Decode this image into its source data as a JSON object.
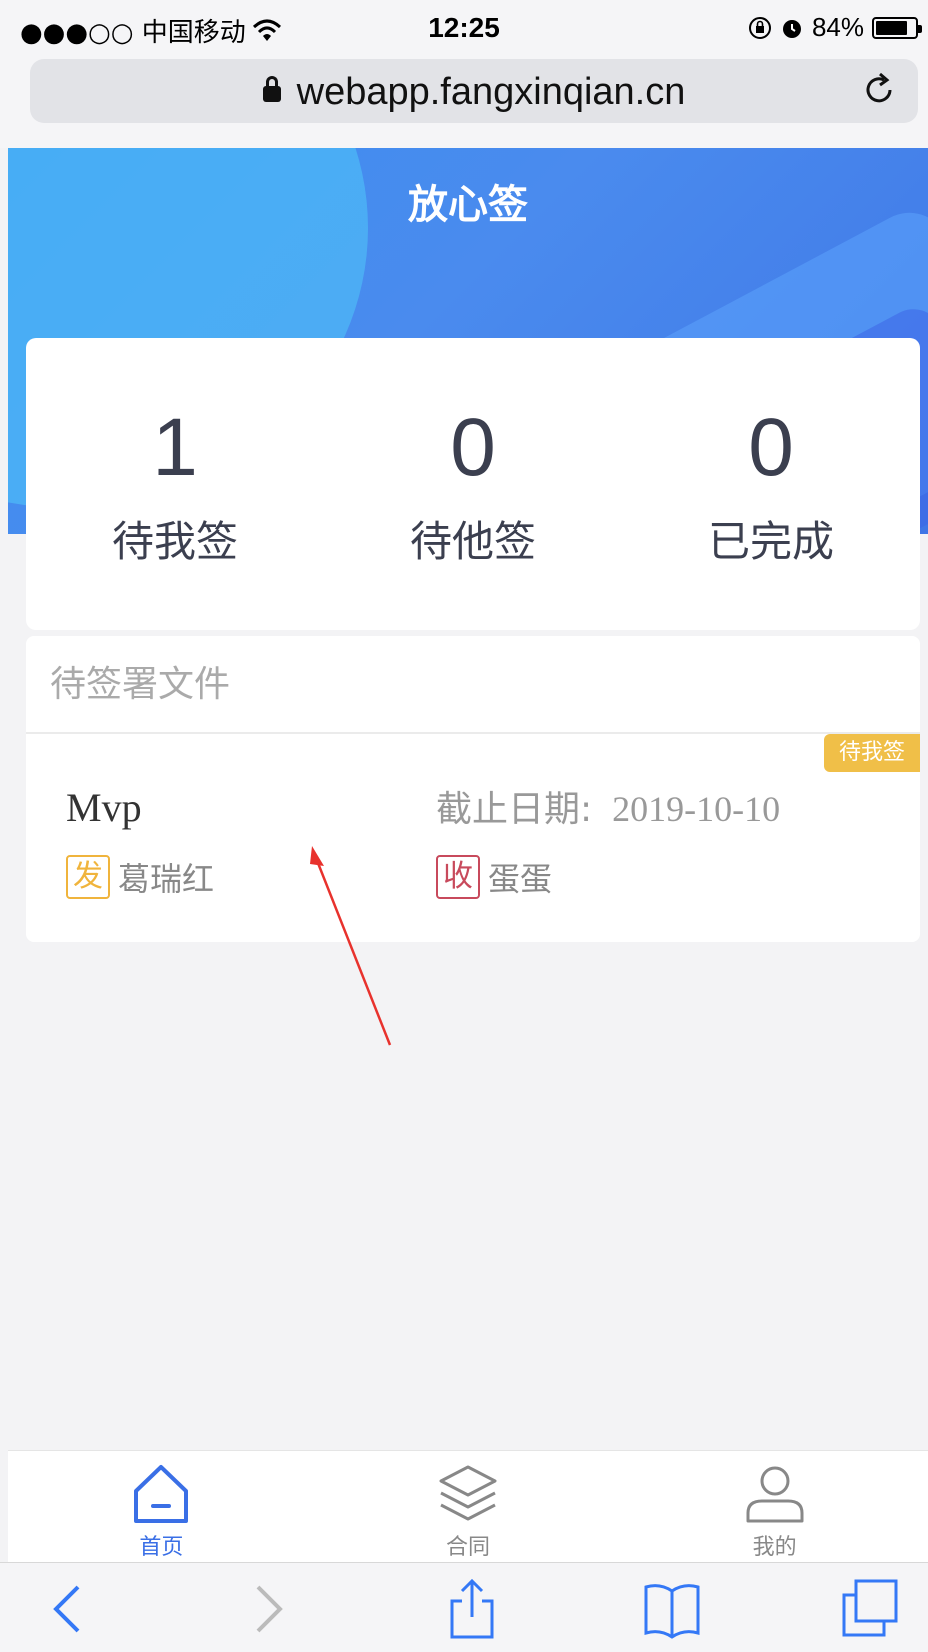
{
  "status_bar": {
    "carrier": "●●●○○ 中国移动",
    "time": "12:25",
    "battery": "84%",
    "battery_level": 0.84
  },
  "browser": {
    "url": "webapp.fangxinqian.cn"
  },
  "header": {
    "title": "放心签"
  },
  "stats": [
    {
      "count": "1",
      "label": "待我签"
    },
    {
      "count": "0",
      "label": "待他签"
    },
    {
      "count": "0",
      "label": "已完成"
    }
  ],
  "pending_section": {
    "title": "待签署文件",
    "documents": [
      {
        "status_badge": "待我签",
        "name": "Mvp",
        "deadline_label": "截止日期:",
        "deadline": "2019-10-10",
        "sender_tag": "发",
        "sender": "葛瑞红",
        "receiver_tag": "收",
        "receiver": "蛋蛋"
      }
    ]
  },
  "tabbar": {
    "tabs": [
      {
        "label": "首页",
        "icon": "home-icon",
        "active": true
      },
      {
        "label": "合同",
        "icon": "layers-icon",
        "active": false
      },
      {
        "label": "我的",
        "icon": "user-icon",
        "active": false
      }
    ]
  },
  "colors": {
    "accent": "#3a6fe6",
    "hero_start": "#3c8df0",
    "badge": "#f0bf48",
    "sender_tag": "#f0b43c",
    "receiver_tag": "#c84a5c",
    "annotation_arrow": "#e8322d"
  }
}
